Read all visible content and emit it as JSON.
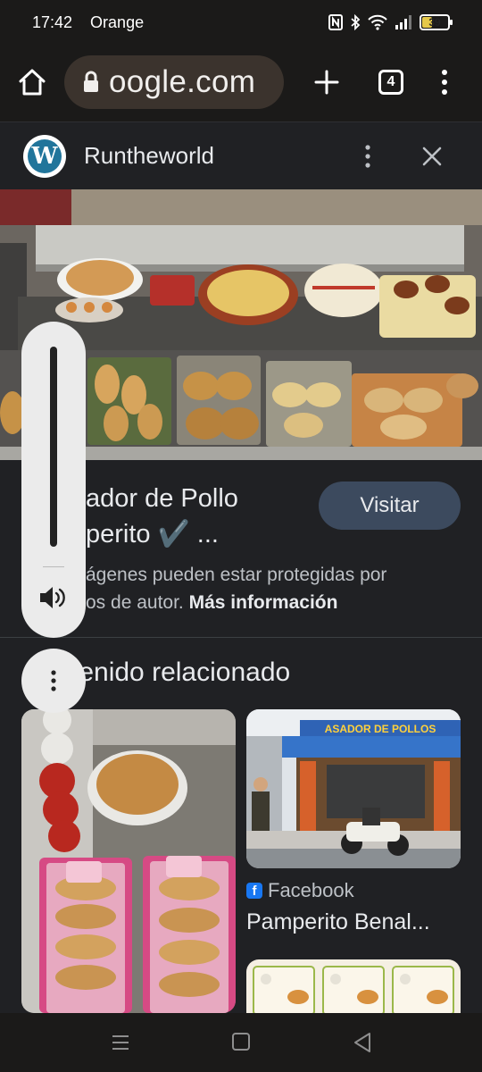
{
  "status_bar": {
    "time": "17:42",
    "carrier": "Orange",
    "battery": "39",
    "icons": [
      "nfc-icon",
      "bluetooth-icon",
      "wifi-icon",
      "signal-icon",
      "battery-icon"
    ]
  },
  "browser": {
    "url": "oogle.com",
    "tab_count": "4",
    "icons": [
      "home-icon",
      "lock-icon",
      "new-tab-icon",
      "tab-switcher-icon",
      "more-menu-icon"
    ]
  },
  "site": {
    "name": "Runtheworld",
    "logo_letter": "W"
  },
  "result": {
    "title": "ador de Pollo\nperito ✔️ ...",
    "visit_label": "Visitar",
    "copyright_text": "ágenes pueden estar protegidas por\nos de autor. ",
    "copyright_link": "Más información"
  },
  "related": {
    "heading": "tenido relacionado",
    "source": "Facebook",
    "caption": "Pamperito Benal...",
    "storefront_sign": "ASADOR DE POLLOS"
  },
  "colors": {
    "accent_button": "#3c4a5e",
    "panel_bg": "#202124",
    "facebook_blue": "#1877f2"
  }
}
